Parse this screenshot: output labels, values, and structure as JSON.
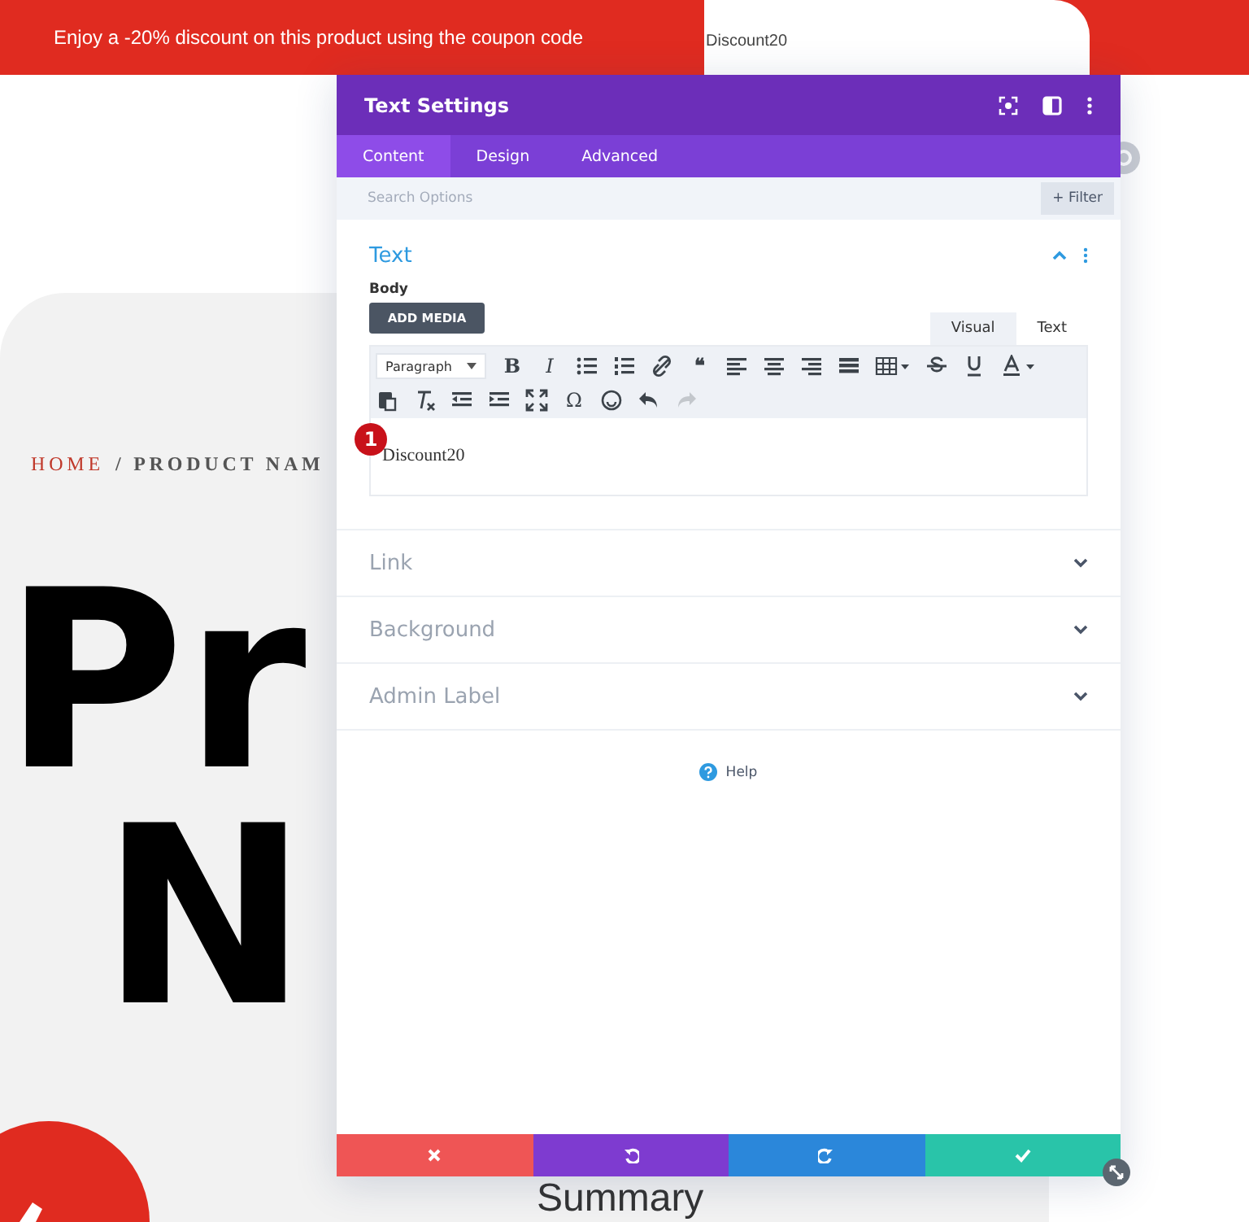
{
  "banner": {
    "text": "Enjoy a -20% discount on this product using the coupon code",
    "coupon": "Discount20"
  },
  "page": {
    "breadcrumb": [
      {
        "label": "HOME",
        "kind": "link"
      },
      {
        "label": "/ PRODUCT NAM",
        "kind": "current"
      }
    ],
    "heading_lines": [
      "Pr",
      "N"
    ],
    "subheading": "Summary"
  },
  "modal": {
    "title": "Text Settings",
    "tabs": [
      {
        "label": "Content",
        "selected": true
      },
      {
        "label": "Design",
        "selected": false
      },
      {
        "label": "Advanced",
        "selected": false
      }
    ],
    "search": {
      "placeholder": "Search Options"
    },
    "filter_button": "+ Filter",
    "section": {
      "title": "Text",
      "expanded": true,
      "field_label": "Body",
      "add_media": "ADD MEDIA",
      "editor_tabs": [
        {
          "label": "Visual",
          "selected": true
        },
        {
          "label": "Text",
          "selected": false
        }
      ],
      "format_select": "Paragraph",
      "toolbar_rows": [
        [
          {
            "kind": "glyph",
            "label": "B"
          },
          {
            "kind": "glyph",
            "label": "I"
          },
          {
            "kind": "icon"
          },
          {
            "kind": "icon"
          },
          {
            "kind": "icon"
          },
          {
            "kind": "glyph",
            "label": "❝"
          },
          {
            "kind": "icon"
          },
          {
            "kind": "icon"
          },
          {
            "kind": "icon"
          },
          {
            "kind": "icon"
          },
          {
            "kind": "icon"
          },
          {
            "kind": "icon"
          },
          {
            "kind": "icon"
          },
          {
            "kind": "icon"
          }
        ],
        [
          {
            "kind": "icon"
          },
          {
            "kind": "icon"
          },
          {
            "kind": "icon"
          },
          {
            "kind": "icon"
          },
          {
            "kind": "icon"
          },
          {
            "kind": "glyph",
            "label": "Ω"
          },
          {
            "kind": "icon"
          },
          {
            "kind": "icon"
          },
          {
            "kind": "icon"
          }
        ]
      ],
      "content": "Discount20",
      "badge": "1"
    },
    "collapsed_sections": [
      {
        "title": "Link",
        "expanded": false
      },
      {
        "title": "Background",
        "expanded": false
      },
      {
        "title": "Admin Label",
        "expanded": false
      }
    ],
    "help": "Help"
  }
}
